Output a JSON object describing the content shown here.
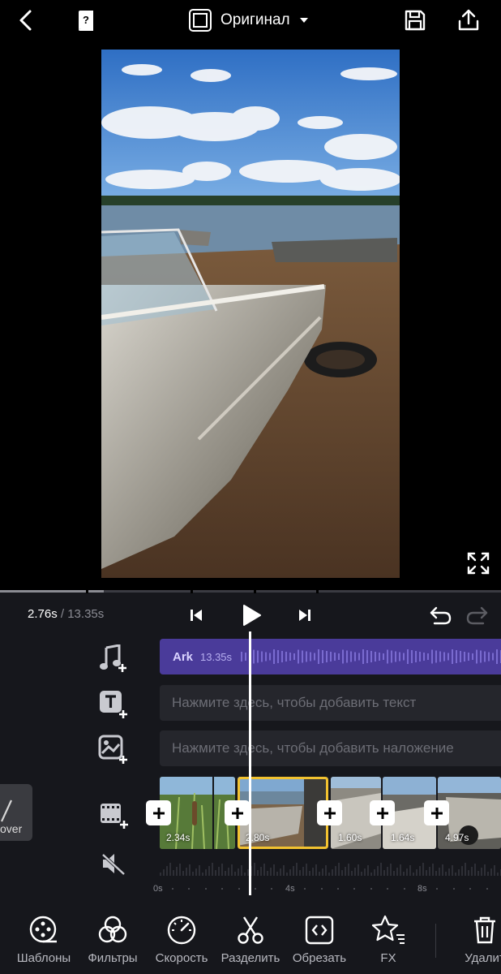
{
  "header": {
    "back": "back-icon",
    "help": "help-book-icon",
    "ratio_label": "Оригинал",
    "save": "save-icon",
    "export": "export-icon"
  },
  "playback": {
    "current_time": "2.76s",
    "separator": "/",
    "total_time": "13.35s",
    "progress": 0.207
  },
  "tracks": {
    "audio": {
      "name": "Ark",
      "duration": "13.35s"
    },
    "text_placeholder": "Нажмите здесь, чтобы добавить текст",
    "overlay_placeholder": "Нажмите здесь, чтобы добавить наложение"
  },
  "cover": {
    "label": "over"
  },
  "clips": [
    {
      "duration": "2.34s"
    },
    {
      "duration": "2.80s",
      "selected": true
    },
    {
      "duration": "1.60s"
    },
    {
      "duration": "1.64s"
    },
    {
      "duration": "4.97s"
    }
  ],
  "ruler": [
    "0s",
    "4s",
    "8s"
  ],
  "tools": [
    {
      "label": "Шаблоны",
      "icon": "templates-icon"
    },
    {
      "label": "Фильтры",
      "icon": "filters-icon"
    },
    {
      "label": "Скорость",
      "icon": "speed-icon"
    },
    {
      "label": "Разделить",
      "icon": "scissors-icon"
    },
    {
      "label": "Обрезать",
      "icon": "trim-icon"
    },
    {
      "label": "FX",
      "icon": "fx-icon"
    },
    {
      "label": "Удалит",
      "icon": "trash-icon"
    }
  ],
  "colors": {
    "accent_audio": "#4a3b9a",
    "selection": "#f2c230",
    "panel": "#16171c"
  }
}
